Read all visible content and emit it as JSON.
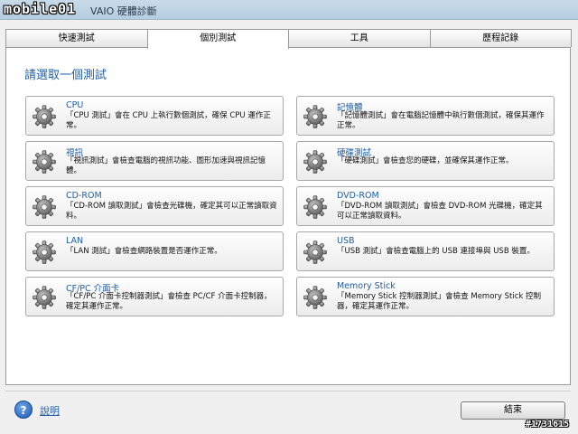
{
  "window": {
    "logo": "mobile01",
    "title": "VAIO 硬體診斷"
  },
  "tabs": [
    {
      "label": "快速測試",
      "active": false
    },
    {
      "label": "個別測試",
      "active": true
    },
    {
      "label": "工具",
      "active": false
    },
    {
      "label": "歷程記錄",
      "active": false
    }
  ],
  "main": {
    "heading": "請選取一個測試",
    "tests": [
      {
        "title": "CPU",
        "desc": "「CPU 測試」會在 CPU 上執行數個測試，確保 CPU 運作正常。",
        "icon": "gear-icon"
      },
      {
        "title": "記憶體",
        "desc": "「記憶體測試」會在電腦記憶體中執行數個測試，確保其運作正常。",
        "icon": "gear-icon"
      },
      {
        "title": "視訊",
        "desc": "「視訊測試」會檢查電腦的視訊功能、圖形加速與視訊記憶體。",
        "icon": "gear-icon"
      },
      {
        "title": "硬碟測試",
        "desc": "「硬碟測試」會檢查您的硬碟，並確保其運作正常。",
        "icon": "gear-icon"
      },
      {
        "title": "CD-ROM",
        "desc": "「CD-ROM 讀取測試」會檢查光碟機，確定其可以正常讀取資料。",
        "icon": "gear-icon"
      },
      {
        "title": "DVD-ROM",
        "desc": "「DVD-ROM 讀取測試」會檢查 DVD-ROM 光碟機，確定其可以正常讀取資料。",
        "icon": "gear-icon"
      },
      {
        "title": "LAN",
        "desc": "「LAN 測試」會檢查網路裝置是否運作正常。",
        "icon": "gear-icon"
      },
      {
        "title": "USB",
        "desc": "「USB 測試」會檢查電腦上的 USB 連接埠與 USB 裝置。",
        "icon": "gear-icon"
      },
      {
        "title": "CF/PC 介面卡",
        "desc": "「CF/PC 介面卡控制器測試」會檢查 PC/CF 介面卡控制器，確定其運作正常。",
        "icon": "gear-icon"
      },
      {
        "title": "Memory Stick",
        "desc": "「Memory Stick 控制器測試」會檢查 Memory Stick 控制器，確定其運作正常。",
        "icon": "gear-icon"
      }
    ]
  },
  "footer": {
    "help_icon": "?",
    "help_label": "說明",
    "close_label": "結束"
  },
  "watermark": "#1731615"
}
